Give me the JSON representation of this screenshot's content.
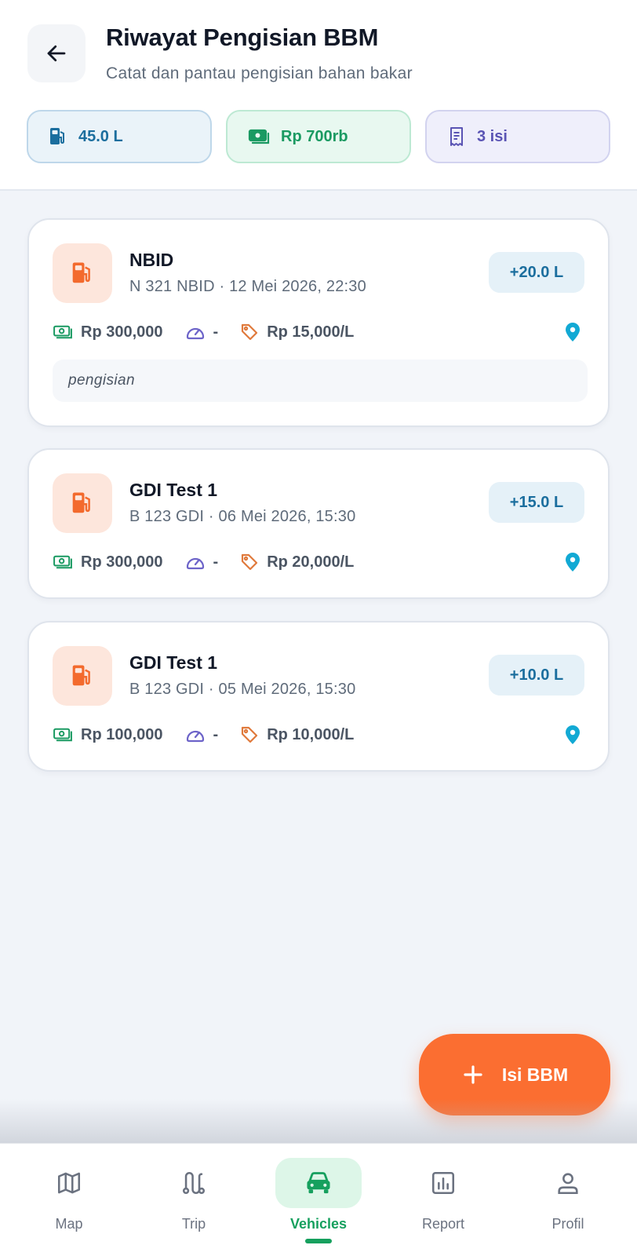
{
  "header": {
    "title": "Riwayat Pengisian BBM",
    "subtitle": "Catat dan pantau pengisian bahan bakar",
    "back_icon": "arrow-left-icon"
  },
  "summary": {
    "total_liters": "45.0 L",
    "total_cost": "Rp 700rb",
    "total_count": "3 isi"
  },
  "records": [
    {
      "vehicle_name": "NBID",
      "details": "N 321 NBID · 12 Mei 2026, 22:30",
      "liters": "+20.0 L",
      "cost": "Rp 300,000",
      "odometer": "-",
      "price_per_liter": "Rp 15,000/L",
      "note": "pengisian"
    },
    {
      "vehicle_name": "GDI Test 1",
      "details": "B 123 GDI · 06 Mei 2026, 15:30",
      "liters": "+15.0 L",
      "cost": "Rp 300,000",
      "odometer": "-",
      "price_per_liter": "Rp 20,000/L"
    },
    {
      "vehicle_name": "GDI Test 1",
      "details": "B 123 GDI · 05 Mei 2026, 15:30",
      "liters": "+10.0 L",
      "cost": "Rp 100,000",
      "odometer": "-",
      "price_per_liter": "Rp 10,000/L"
    }
  ],
  "fab": {
    "label": "Isi BBM"
  },
  "nav": {
    "items": [
      {
        "label": "Map",
        "icon": "map-icon"
      },
      {
        "label": "Trip",
        "icon": "route-icon"
      },
      {
        "label": "Vehicles",
        "icon": "car-icon",
        "active": true
      },
      {
        "label": "Report",
        "icon": "bar-chart-icon"
      },
      {
        "label": "Profil",
        "icon": "user-icon"
      }
    ]
  },
  "colors": {
    "accent_orange": "#fb6e31",
    "active_green": "#16a05e",
    "liter_blue": "#1b6e9e",
    "cost_green": "#1a9a62",
    "count_purple": "#5a54b4",
    "odometer_purple": "#6d64c9",
    "price_orange": "#e07a3c",
    "pin_cyan": "#12a9d4"
  }
}
